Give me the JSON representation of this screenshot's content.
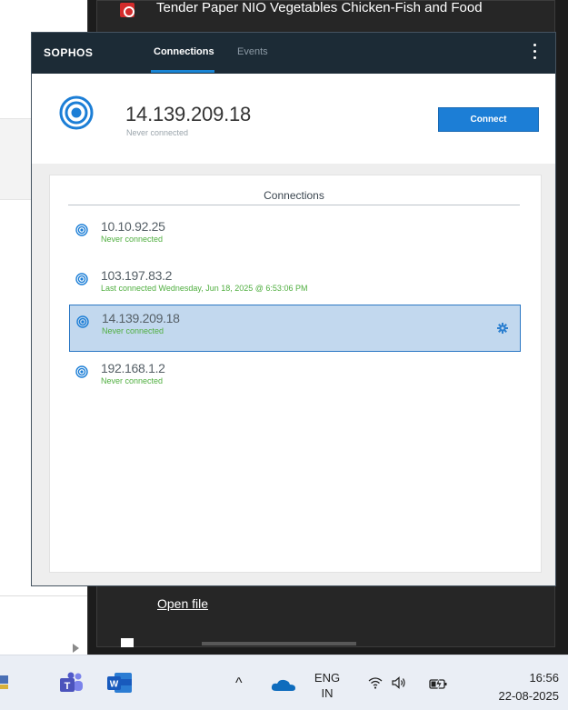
{
  "background": {
    "document_title": "Tender Paper NIO Vegetables Chicken-Fish and Food",
    "open_file_label": "Open file"
  },
  "app": {
    "logo": "SOPHOS",
    "tabs": [
      {
        "label": "Connections",
        "active": true
      },
      {
        "label": "Events",
        "active": false
      }
    ],
    "menu_icon": "kebab-menu-icon"
  },
  "current": {
    "ip": "14.139.209.18",
    "status": "Never connected",
    "connect_label": "Connect"
  },
  "connections": {
    "title": "Connections",
    "items": [
      {
        "ip": "10.10.92.25",
        "status": "Never connected",
        "selected": false
      },
      {
        "ip": "103.197.83.2",
        "status": "Last connected Wednesday, Jun 18, 2025 @ 6:53:06 PM",
        "selected": false
      },
      {
        "ip": "14.139.209.18",
        "status": "Never connected",
        "selected": true
      },
      {
        "ip": "192.168.1.2",
        "status": "Never connected",
        "selected": false
      }
    ]
  },
  "taskbar": {
    "language": "ENG",
    "region": "IN",
    "time": "16:56",
    "date": "22-08-2025",
    "caret_glyph": "^"
  },
  "colors": {
    "accent": "#1c7ed6",
    "topbar": "#1c2b36",
    "status_green": "#4fae3f",
    "selected_row": "#c2d8ee"
  }
}
